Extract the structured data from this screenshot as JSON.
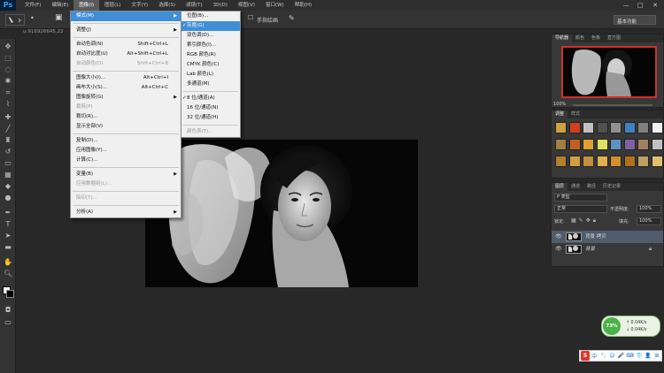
{
  "app": {
    "logo": "Ps",
    "menus": [
      "文件(F)",
      "编辑(E)",
      "图像(I)",
      "图层(L)",
      "文字(Y)",
      "选择(S)",
      "滤镜(T)",
      "3D(D)",
      "视图(V)",
      "窗口(W)",
      "帮助(H)"
    ],
    "window_controls": [
      "—",
      "□",
      "✕"
    ]
  },
  "options_bar": {
    "smudge_label": "手指绘画",
    "workspace": "基本功能"
  },
  "doc_tab": "u:916926645,22",
  "image_menu": {
    "items": [
      {
        "label": "模式(M)",
        "shortcut": "",
        "submenu": true,
        "highlight": true
      },
      {
        "sep": true
      },
      {
        "label": "调整(J)",
        "shortcut": "",
        "submenu": true
      },
      {
        "sep": true
      },
      {
        "label": "自动色调(N)",
        "shortcut": "Shift+Ctrl+L"
      },
      {
        "label": "自动对比度(U)",
        "shortcut": "Alt+Shift+Ctrl+L"
      },
      {
        "label": "自动颜色(O)",
        "shortcut": "Shift+Ctrl+B",
        "disabled": true
      },
      {
        "sep": true
      },
      {
        "label": "图像大小(I)...",
        "shortcut": "Alt+Ctrl+I"
      },
      {
        "label": "画布大小(S)...",
        "shortcut": "Alt+Ctrl+C"
      },
      {
        "label": "图像旋转(G)",
        "shortcut": "",
        "submenu": true
      },
      {
        "label": "裁剪(P)",
        "shortcut": "",
        "disabled": true
      },
      {
        "label": "裁切(R)...",
        "shortcut": ""
      },
      {
        "label": "显示全部(V)",
        "shortcut": ""
      },
      {
        "sep": true
      },
      {
        "label": "复制(D)...",
        "shortcut": ""
      },
      {
        "label": "应用图像(Y)...",
        "shortcut": ""
      },
      {
        "label": "计算(C)...",
        "shortcut": ""
      },
      {
        "sep": true
      },
      {
        "label": "变量(B)",
        "shortcut": "",
        "submenu": true
      },
      {
        "label": "应用数据组(L)...",
        "shortcut": "",
        "disabled": true
      },
      {
        "sep": true
      },
      {
        "label": "陷印(T)...",
        "shortcut": "",
        "disabled": true
      },
      {
        "sep": true
      },
      {
        "label": "分析(A)",
        "shortcut": "",
        "submenu": true
      }
    ]
  },
  "mode_menu": {
    "items": [
      {
        "label": "位图(B)..."
      },
      {
        "label": "灰度(G)",
        "checked": true,
        "highlight": true
      },
      {
        "label": "双色调(D)..."
      },
      {
        "label": "索引颜色(I)..."
      },
      {
        "label": "RGB 颜色(R)"
      },
      {
        "label": "CMYK 颜色(C)"
      },
      {
        "label": "Lab 颜色(L)"
      },
      {
        "label": "多通道(M)"
      },
      {
        "sep": true
      },
      {
        "label": "8 位/通道(A)",
        "checked": true
      },
      {
        "label": "16 位/通道(N)"
      },
      {
        "label": "32 位/通道(H)"
      },
      {
        "sep": true
      },
      {
        "label": "颜色表(T)...",
        "disabled": true
      }
    ]
  },
  "navigator_panel": {
    "tabs": [
      "导航器",
      "颜色",
      "色板",
      "直方图"
    ],
    "zoom": "100%"
  },
  "styles_panel": {
    "tabs": [
      "调整",
      "样式"
    ]
  },
  "layers_panel": {
    "tabs": [
      "图层",
      "通道",
      "路径",
      "历史记录"
    ],
    "filter": "P 类型",
    "blend_mode": "正常",
    "opacity_label": "不透明度:",
    "opacity": "100%",
    "lock_label": "锁定:",
    "fill_label": "填充:",
    "fill": "100%",
    "layers": [
      {
        "name": "背景 拷贝",
        "selected": true
      },
      {
        "name": "背景",
        "italic": true,
        "locked": true
      }
    ]
  },
  "net_widget": {
    "percent": "73%",
    "up": "0.04K/s",
    "down": "0.04K/s"
  },
  "ime_bar": [
    "S",
    "中",
    "°,",
    "☺",
    "🎤",
    "⌨",
    "👕",
    "👤",
    "⊞"
  ]
}
